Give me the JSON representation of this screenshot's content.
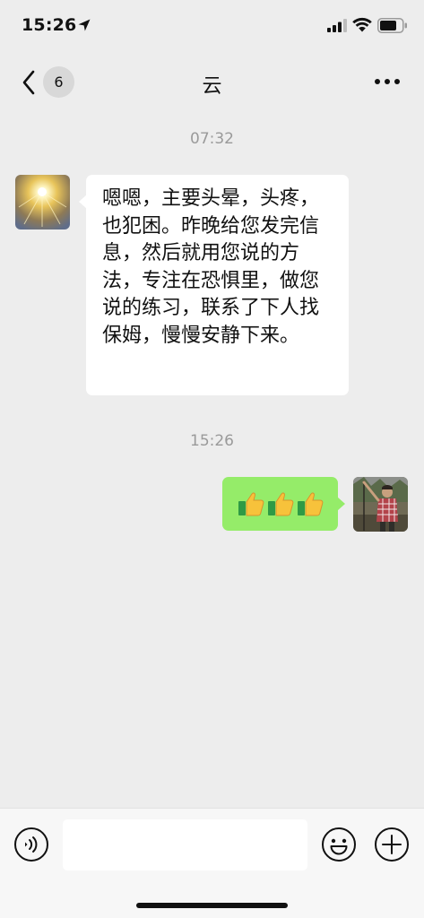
{
  "status_bar": {
    "time": "15:26",
    "icons": [
      "location-arrow-icon",
      "cell-signal-icon",
      "wifi-icon",
      "battery-icon"
    ]
  },
  "nav": {
    "unread_count": "6",
    "title": "云",
    "back_icon": "chevron-left-icon",
    "more_icon": "ellipsis-icon"
  },
  "messages": [
    {
      "timestamp": "07:32",
      "direction": "incoming",
      "text": "嗯嗯，主要头晕，头疼，也犯困。昨晚给您发完信息，然后就用您说的方法，专注在恐惧里，做您说的练习，联系了下人找保姆，慢慢安静下来。",
      "avatar": "golden-light-avatar"
    },
    {
      "timestamp": "15:26",
      "direction": "outgoing",
      "emoji": [
        "thumbs-up",
        "thumbs-up",
        "thumbs-up"
      ],
      "avatar": "user-photo-avatar"
    }
  ],
  "input_bar": {
    "voice_icon": "voice-icon",
    "input_value": "",
    "emoji_icon": "smiley-icon",
    "plus_icon": "plus-icon"
  },
  "colors": {
    "background": "#ededed",
    "incoming_bubble": "#ffffff",
    "outgoing_bubble": "#95ec69",
    "timestamp": "#9a9a9a"
  }
}
